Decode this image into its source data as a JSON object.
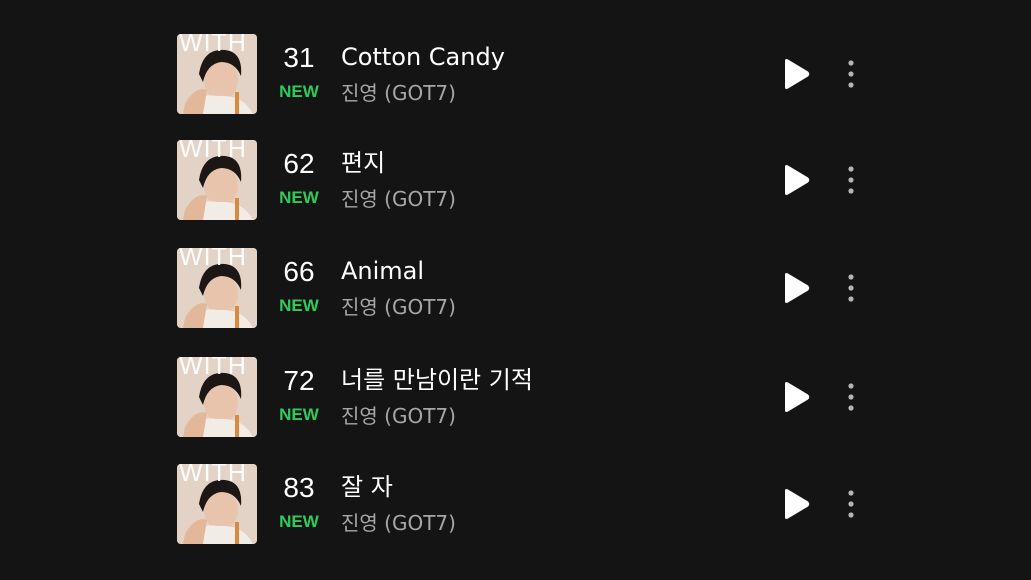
{
  "tracks": [
    {
      "rank": "31",
      "badge": "NEW",
      "title": "Cotton Candy",
      "artist": "진영 (GOT7)",
      "cover_text": "WITH"
    },
    {
      "rank": "62",
      "badge": "NEW",
      "title": "편지",
      "artist": "진영 (GOT7)",
      "cover_text": "WITH"
    },
    {
      "rank": "66",
      "badge": "NEW",
      "title": "Animal",
      "artist": "진영 (GOT7)",
      "cover_text": "WITH"
    },
    {
      "rank": "72",
      "badge": "NEW",
      "title": "너를 만남이란 기적",
      "artist": "진영 (GOT7)",
      "cover_text": "WITH"
    },
    {
      "rank": "83",
      "badge": "NEW",
      "title": "잘 자",
      "artist": "진영 (GOT7)",
      "cover_text": "WITH"
    }
  ],
  "icons": {
    "play": "play-icon",
    "more": "more-vertical-icon"
  },
  "colors": {
    "background": "#141414",
    "badge_new": "#2fcb5a",
    "title": "#ffffff",
    "artist": "#a7a7a7"
  }
}
